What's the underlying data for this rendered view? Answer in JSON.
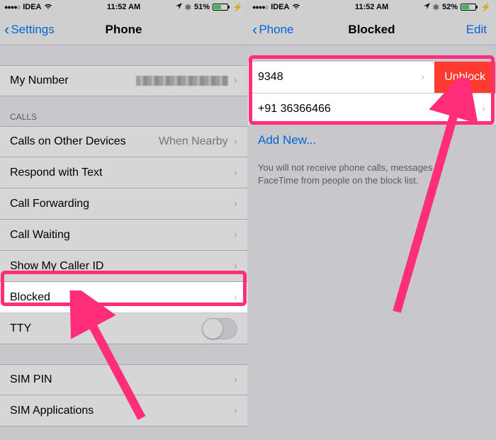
{
  "left": {
    "status": {
      "carrier": "IDEA",
      "time": "11:52 AM",
      "battery_pct": "51%"
    },
    "nav": {
      "back": "Settings",
      "title": "Phone"
    },
    "my_number_label": "My Number",
    "calls_header": "CALLS",
    "items": {
      "other_devices": "Calls on Other Devices",
      "other_devices_value": "When Nearby",
      "respond": "Respond with Text",
      "forwarding": "Call Forwarding",
      "waiting": "Call Waiting",
      "caller_id": "Show My Caller ID",
      "blocked": "Blocked",
      "tty": "TTY",
      "sim_pin": "SIM PIN",
      "sim_apps": "SIM Applications"
    }
  },
  "right": {
    "status": {
      "carrier": "IDEA",
      "time": "11:52 AM",
      "battery_pct": "52%"
    },
    "nav": {
      "back": "Phone",
      "title": "Blocked",
      "edit": "Edit"
    },
    "entries": [
      {
        "number": "9348",
        "unblock": "Unblock"
      },
      {
        "number": "+91 36366466"
      }
    ],
    "add_new": "Add New...",
    "footer": "You will not receive phone calls, messages or FaceTime from people on the block list."
  }
}
